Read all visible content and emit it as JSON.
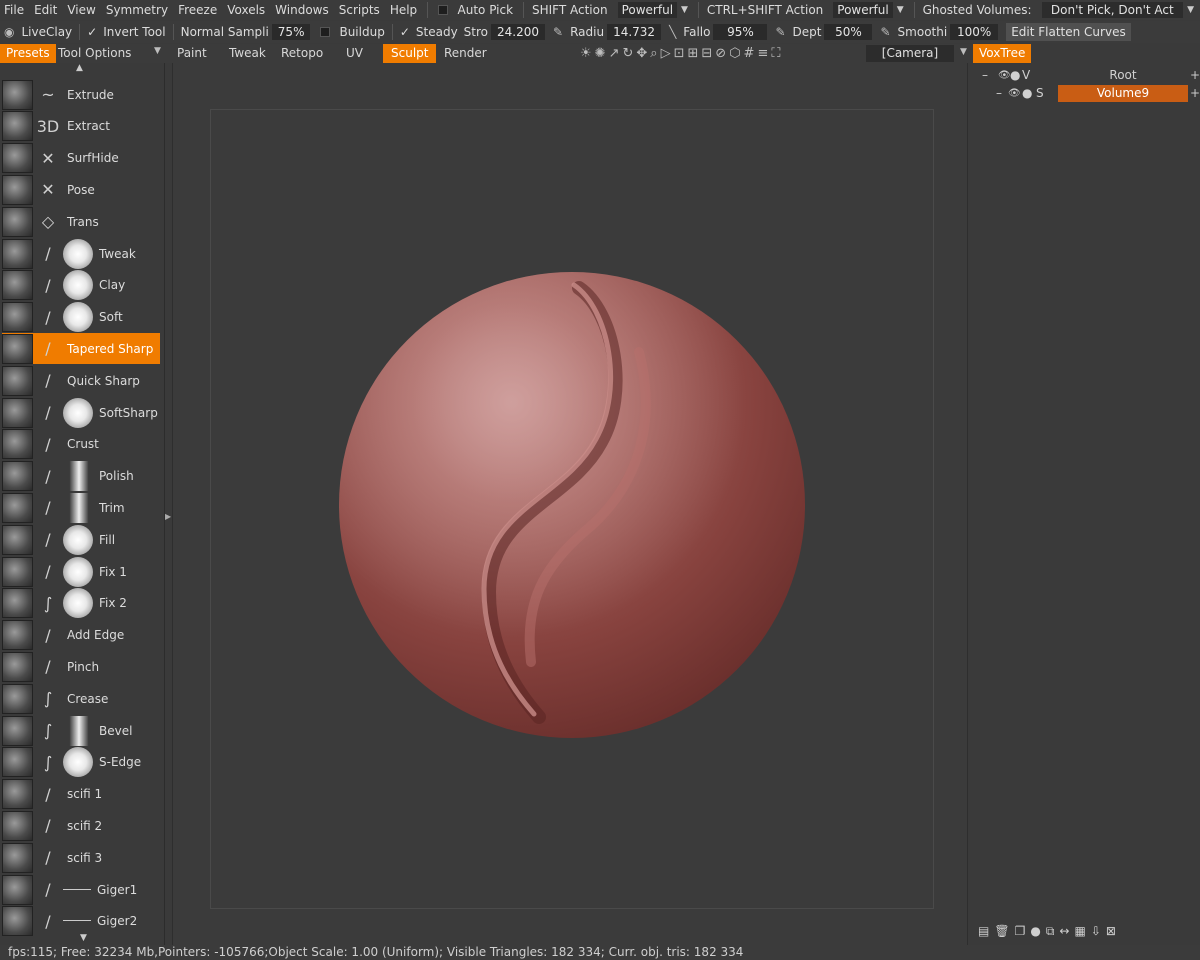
{
  "menubar": {
    "items": [
      "File",
      "Edit",
      "View",
      "Symmetry",
      "Freeze",
      "Voxels",
      "Windows",
      "Scripts",
      "Help"
    ],
    "auto_pick": "Auto Pick",
    "shift_action_label": "SHIFT Action",
    "shift_action_value": "Powerful",
    "ctrl_shift_action_label": "CTRL+SHIFT Action",
    "ctrl_shift_action_value": "Powerful",
    "ghosted_label": "Ghosted Volumes:",
    "ghosted_value": "Don't Pick, Don't Act"
  },
  "toolbar": {
    "tool_name": "LiveClay",
    "invert_tool": "Invert Tool",
    "sampling_label": "Normal Sampli",
    "sampling_value": "75%",
    "buildup": "Buildup",
    "steady_label": "Steady",
    "stroke_label": "Stro",
    "stroke_value": "24.200",
    "radius_label": "Radiu",
    "radius_value": "14.732",
    "falloff_label": "Fallo",
    "falloff_value": "95%",
    "depth_label": "Dept",
    "depth_value": "50%",
    "smoothing_label": "Smoothi",
    "smoothing_value": "100%",
    "edit_flatten": "Edit Flatten Curves"
  },
  "tabs": {
    "presets": "Presets",
    "tool_options": "Tool Options",
    "modes": [
      "Paint",
      "Tweak",
      "Retopo",
      "UV",
      "Sculpt",
      "Render"
    ],
    "active_mode": "Sculpt",
    "camera": "[Camera]"
  },
  "presets": [
    {
      "label": "Extrude",
      "gesture": "~",
      "alpha": "none"
    },
    {
      "label": "Extract",
      "gesture": "3D",
      "alpha": "none"
    },
    {
      "label": "SurfHide",
      "gesture": "✕",
      "alpha": "none"
    },
    {
      "label": "Pose",
      "gesture": "✕",
      "alpha": "none"
    },
    {
      "label": "Trans",
      "gesture": "◇",
      "alpha": "none"
    },
    {
      "label": "Tweak",
      "gesture": "/",
      "alpha": "soft"
    },
    {
      "label": "Clay",
      "gesture": "/",
      "alpha": "hard"
    },
    {
      "label": "Soft",
      "gesture": "/",
      "alpha": "soft"
    },
    {
      "label": "Tapered Sharp",
      "gesture": "/",
      "alpha": "none"
    },
    {
      "label": "Quick Sharp",
      "gesture": "/",
      "alpha": "none"
    },
    {
      "label": "SoftSharp",
      "gesture": "/",
      "alpha": "soft"
    },
    {
      "label": "Crust",
      "gesture": "/",
      "alpha": "none"
    },
    {
      "label": "Polish",
      "gesture": "/",
      "alpha": "bar"
    },
    {
      "label": "Trim",
      "gesture": "/",
      "alpha": "bar"
    },
    {
      "label": "Fill",
      "gesture": "/",
      "alpha": "hard"
    },
    {
      "label": "Fix 1",
      "gesture": "/",
      "alpha": "hard"
    },
    {
      "label": "Fix 2",
      "gesture": "∫",
      "alpha": "hard"
    },
    {
      "label": "Add Edge",
      "gesture": "/",
      "alpha": "none"
    },
    {
      "label": "Pinch",
      "gesture": "/",
      "alpha": "none"
    },
    {
      "label": "Crease",
      "gesture": "∫",
      "alpha": "none"
    },
    {
      "label": "Bevel",
      "gesture": "∫",
      "alpha": "bar"
    },
    {
      "label": "S-Edge",
      "gesture": "∫",
      "alpha": "hard"
    },
    {
      "label": "scifi 1",
      "gesture": "/",
      "alpha": "none"
    },
    {
      "label": "scifi 2",
      "gesture": "/",
      "alpha": "none"
    },
    {
      "label": "scifi 3",
      "gesture": "/",
      "alpha": "none"
    },
    {
      "label": "Giger1",
      "gesture": "/",
      "alpha": "line"
    },
    {
      "label": "Giger2",
      "gesture": "/",
      "alpha": "line"
    }
  ],
  "active_preset": "Tapered Sharp",
  "voxtree": {
    "tab": "VoxTree",
    "rows": [
      {
        "type": "V",
        "name": "Root",
        "selected": false
      },
      {
        "type": "S",
        "name": "Volume9",
        "selected": true
      }
    ]
  },
  "status": "fps:115;   Free: 32234  Mb,Pointers: -105766;Object  Scale: 1.00  (Uniform);  Visible  Triangles: 182 334;  Curr. obj.  tris: 182 334",
  "colors": {
    "accent": "#f07c00",
    "selection": "#c95d14",
    "material": "#8a4440"
  }
}
